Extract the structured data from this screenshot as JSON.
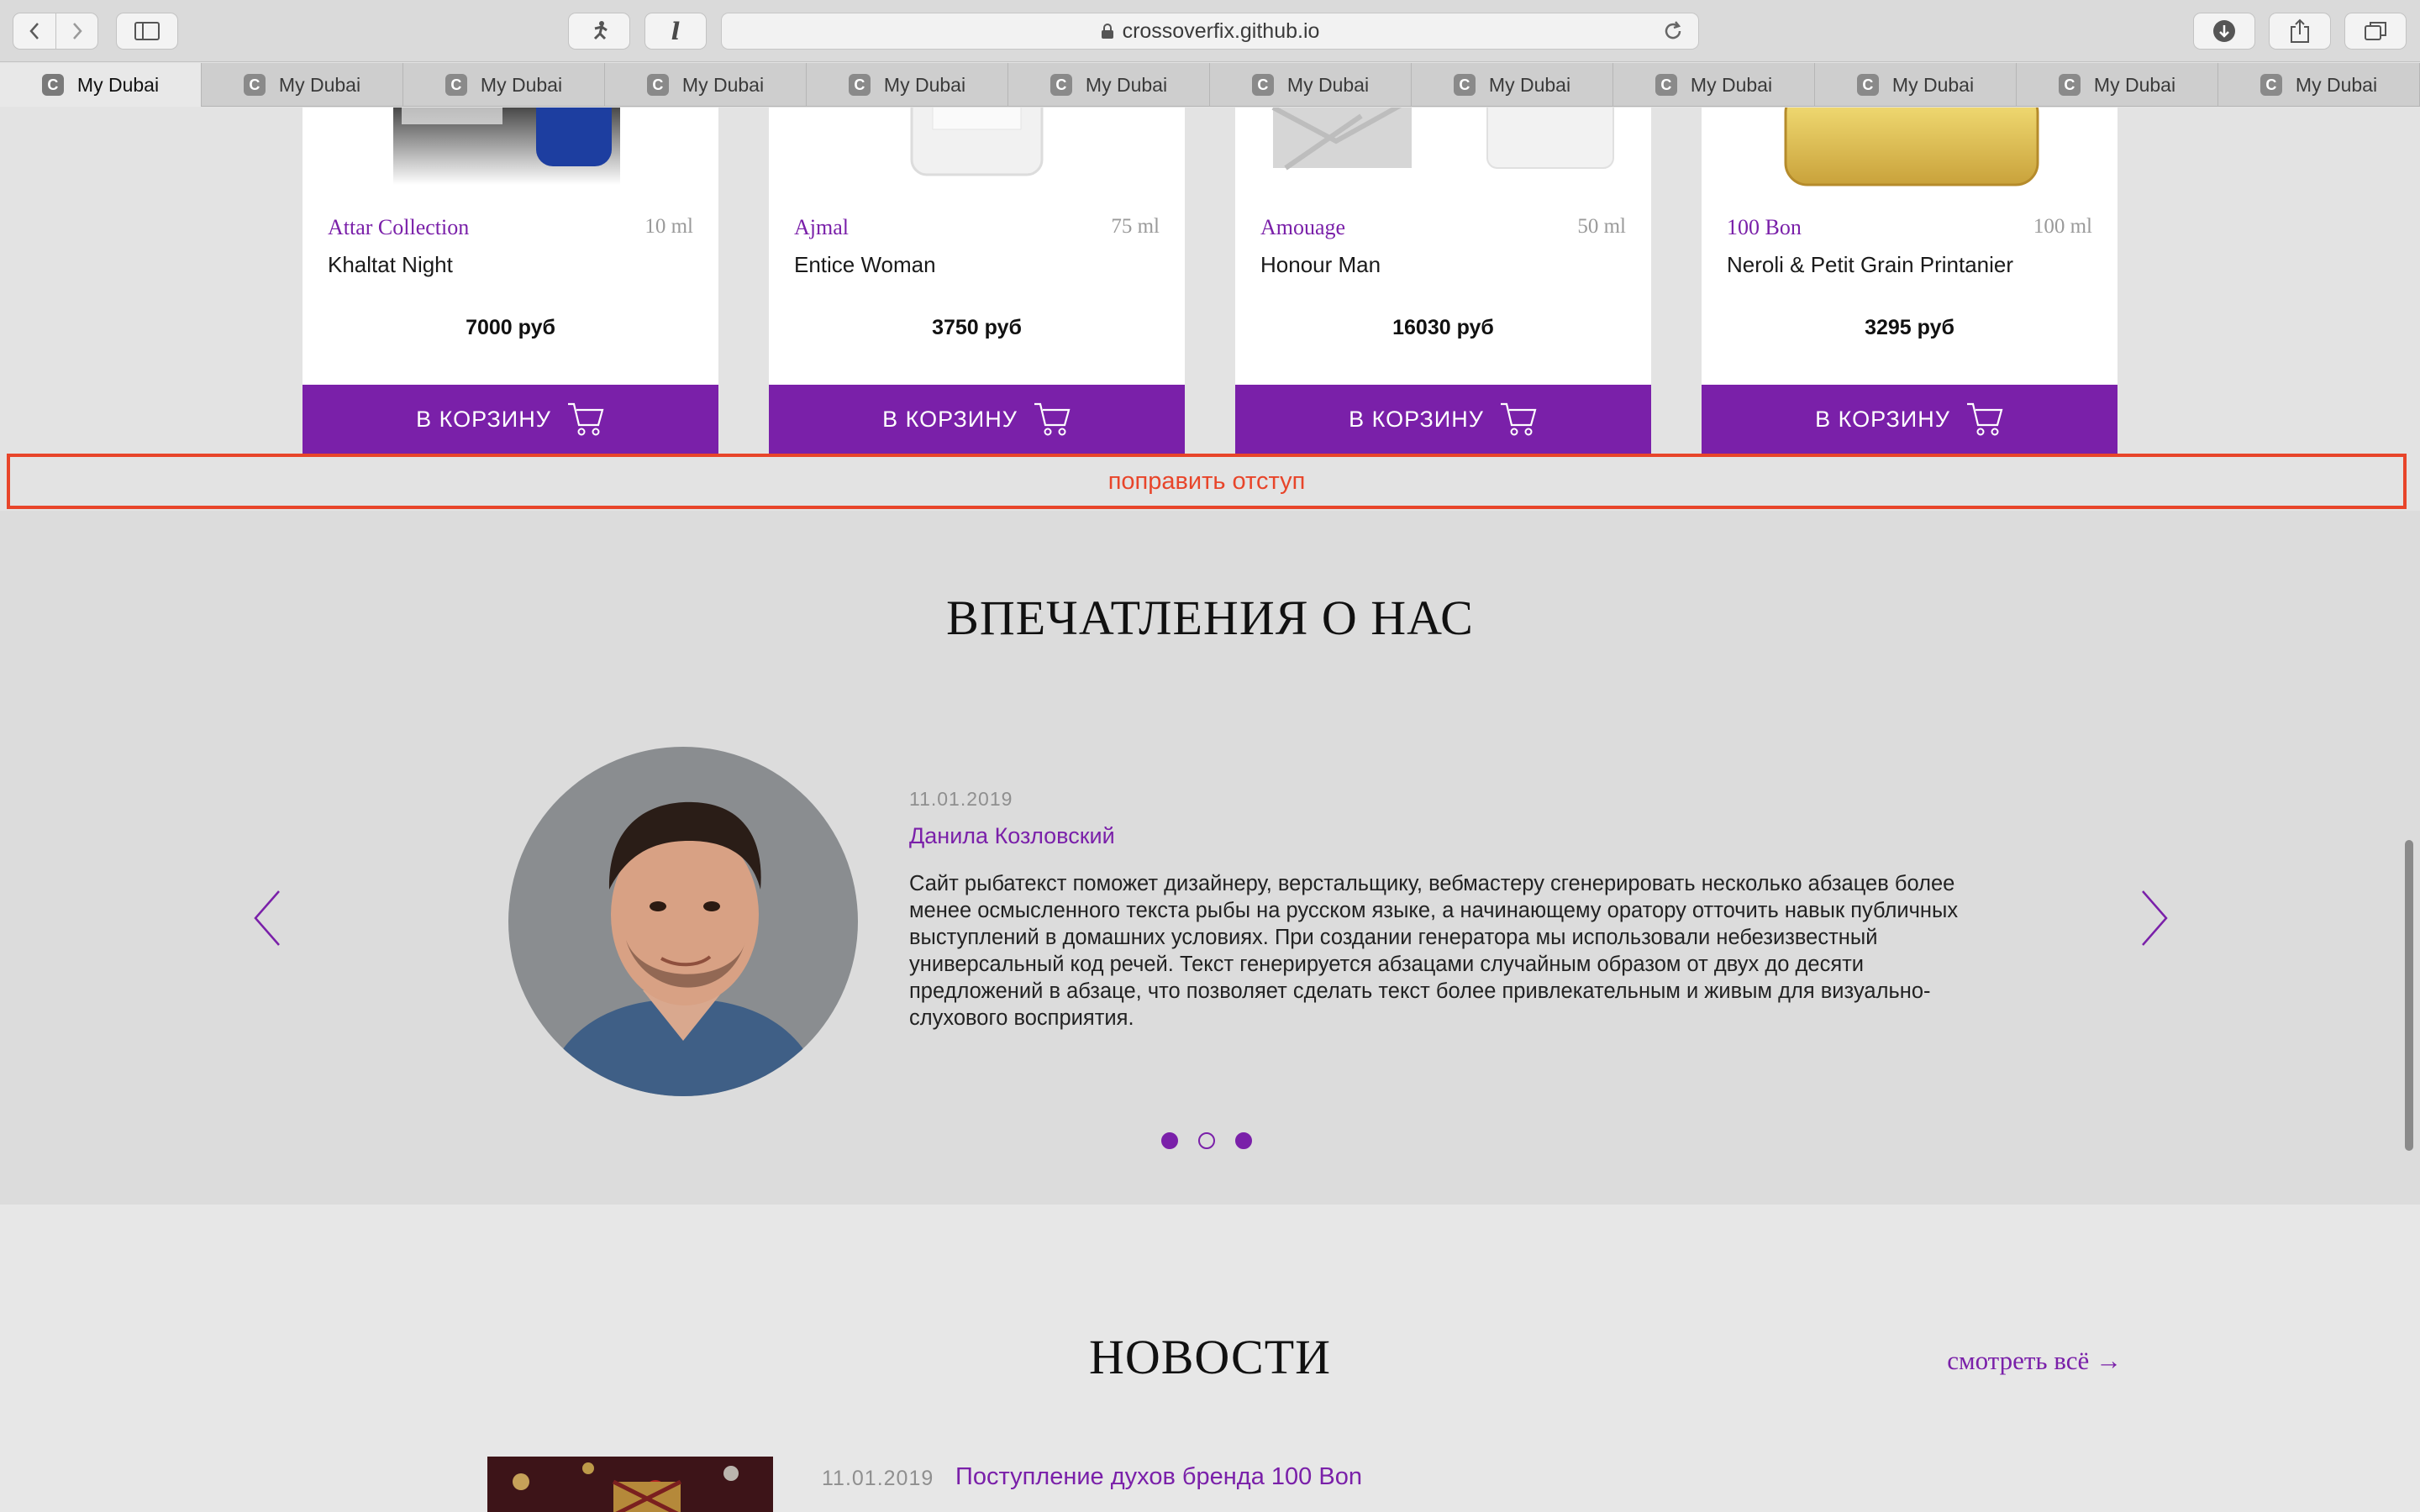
{
  "browser": {
    "url": "crossoverfix.github.io",
    "tabs": [
      {
        "label": "My Dubai",
        "favicon": "C",
        "active": true
      },
      {
        "label": "My Dubai",
        "favicon": "C"
      },
      {
        "label": "My Dubai",
        "favicon": "C"
      },
      {
        "label": "My Dubai",
        "favicon": "C"
      },
      {
        "label": "My Dubai",
        "favicon": "C"
      },
      {
        "label": "My Dubai",
        "favicon": "C"
      },
      {
        "label": "My Dubai",
        "favicon": "C"
      },
      {
        "label": "My Dubai",
        "favicon": "C"
      },
      {
        "label": "My Dubai",
        "favicon": "C"
      },
      {
        "label": "My Dubai",
        "favicon": "C"
      },
      {
        "label": "My Dubai",
        "favicon": "C"
      },
      {
        "label": "My Dubai",
        "favicon": "C"
      }
    ],
    "new_tab_icon": "plus-icon"
  },
  "products": [
    {
      "brand": "Attar Collection",
      "volume": "10 ml",
      "name": "Khaltat Night",
      "price": "7000 руб",
      "button": "В КОРЗИНУ"
    },
    {
      "brand": "Ajmal",
      "volume": "75 ml",
      "name": "Entice Woman",
      "price": "3750 руб",
      "button": "В КОРЗИНУ"
    },
    {
      "brand": "Amouage",
      "volume": "50 ml",
      "name": "Honour Man",
      "price": "16030 руб",
      "button": "В КОРЗИНУ"
    },
    {
      "brand": "100 Bon",
      "volume": "100 ml",
      "name": "Neroli & Petit Grain Printanier",
      "price": "3295 руб",
      "button": "В КОРЗИНУ"
    }
  ],
  "annotation": "поправить отступ",
  "reviews": {
    "title": "ВПЕЧАТЛЕНИЯ О НАС",
    "date": "11.01.2019",
    "author": "Данила Козловский",
    "text": "Сайт рыбатекст поможет дизайнеру, верстальщику, вебмастеру сгенерировать несколько абзацев более менее осмысленного текста рыбы на русском языке, а начинающему оратору отточить навык публичных выступлений в домашних условиях. При создании генератора мы использовали небезизвестный универсальный код речей. Текст генерируется абзацами случайным образом от двух до десяти предложений в абзаце, что позволяет сделать текст более привлекательным и живым для визуально-слухового восприятия.",
    "slides": 3,
    "current_slide": 2
  },
  "news": {
    "title": "НОВОСТИ",
    "see_all": "смотреть всё →",
    "items": [
      {
        "date": "11.01.2019",
        "title": "Поступление духов бренда 100 Bon"
      }
    ]
  },
  "colors": {
    "accent": "#7a20a9",
    "annotation": "#e8452a"
  }
}
